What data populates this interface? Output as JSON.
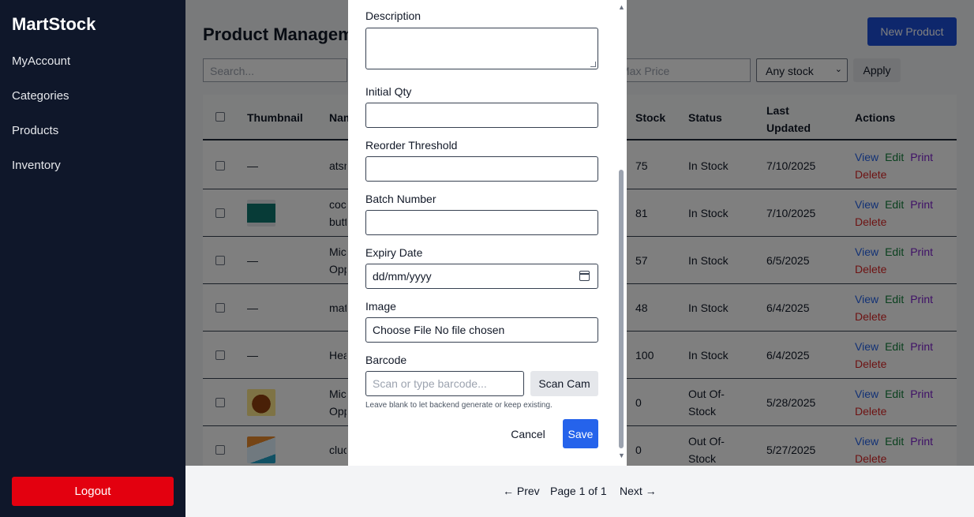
{
  "sidebar": {
    "brand": "MartStock",
    "items": [
      "MyAccount",
      "Categories",
      "Products",
      "Inventory"
    ],
    "logout": "Logout"
  },
  "header": {
    "title": "Product Management",
    "new_product": "New Product"
  },
  "filters": {
    "search_placeholder": "Search...",
    "max_price_placeholder": "Max Price",
    "stock_selected": "Any stock",
    "apply": "Apply"
  },
  "table": {
    "headers": {
      "thumbnail": "Thumbnail",
      "name": "Name",
      "stock": "Stock",
      "status": "Status",
      "last_updated": "Last Updated",
      "actions": "Actions"
    },
    "rows": [
      {
        "thumb": "—",
        "name": "atsm",
        "stock": "75",
        "status": "In Stock",
        "updated": "7/10/2025"
      },
      {
        "thumb": "",
        "name": "coco butt",
        "stock": "81",
        "status": "In Stock",
        "updated": "7/10/2025"
      },
      {
        "thumb": "—",
        "name": "Mic Opp",
        "stock": "57",
        "status": "In Stock",
        "updated": "6/5/2025"
      },
      {
        "thumb": "—",
        "name": "mat",
        "stock": "48",
        "status": "In Stock",
        "updated": "6/4/2025"
      },
      {
        "thumb": "—",
        "name": "Hea",
        "stock": "100",
        "status": "In Stock",
        "updated": "6/4/2025"
      },
      {
        "thumb": "",
        "name": "Mic Opp",
        "stock": "0",
        "status": "Out Of-Stock",
        "updated": "5/28/2025"
      },
      {
        "thumb": "",
        "name": "cluc",
        "stock": "0",
        "status": "Out Of-Stock",
        "updated": "5/27/2025"
      }
    ],
    "actions": {
      "view": "View",
      "edit": "Edit",
      "print": "Print",
      "delete": "Delete"
    }
  },
  "pager": {
    "prev": "← Prev",
    "info": "Page 1 of 1",
    "next": "Next →"
  },
  "modal": {
    "description_label": "Description",
    "initial_qty_label": "Initial Qty",
    "reorder_label": "Reorder Threshold",
    "batch_label": "Batch Number",
    "expiry_label": "Expiry Date",
    "expiry_value": "dd/mm/yyyy",
    "image_label": "Image",
    "image_value": "Choose File No file chosen",
    "barcode_label": "Barcode",
    "barcode_placeholder": "Scan or type barcode...",
    "scan_cam": "Scan Cam",
    "hint": "Leave blank to let backend generate or keep existing.",
    "cancel": "Cancel",
    "save": "Save"
  },
  "colors": {
    "sidebar_bg": "#0f172a",
    "primary": "#2563eb",
    "danger": "#e3000f"
  }
}
